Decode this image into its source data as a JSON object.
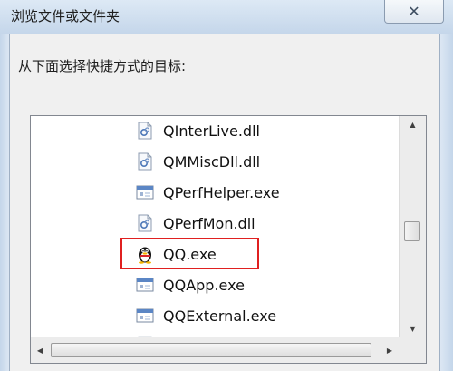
{
  "dialog": {
    "title": "浏览文件或文件夹",
    "close_glyph": "✕",
    "prompt": "从下面选择快捷方式的目标:"
  },
  "file_list": {
    "items": [
      {
        "name": "QInterLive.dll",
        "icon": "dll-file-icon"
      },
      {
        "name": "QMMiscDll.dll",
        "icon": "dll-file-icon"
      },
      {
        "name": "QPerfHelper.exe",
        "icon": "exe-file-icon"
      },
      {
        "name": "QPerfMon.dll",
        "icon": "dll-file-icon"
      },
      {
        "name": "QQ.exe",
        "icon": "qq-penguin-icon",
        "highlighted": true
      },
      {
        "name": "QQApp.exe",
        "icon": "exe-file-icon"
      },
      {
        "name": "QQExternal.exe",
        "icon": "exe-file-icon"
      }
    ],
    "highlight_color": "#e02020"
  },
  "scrollbars": {
    "up_glyph": "▲",
    "down_glyph": "▼",
    "left_glyph": "◀",
    "right_glyph": "▶"
  }
}
